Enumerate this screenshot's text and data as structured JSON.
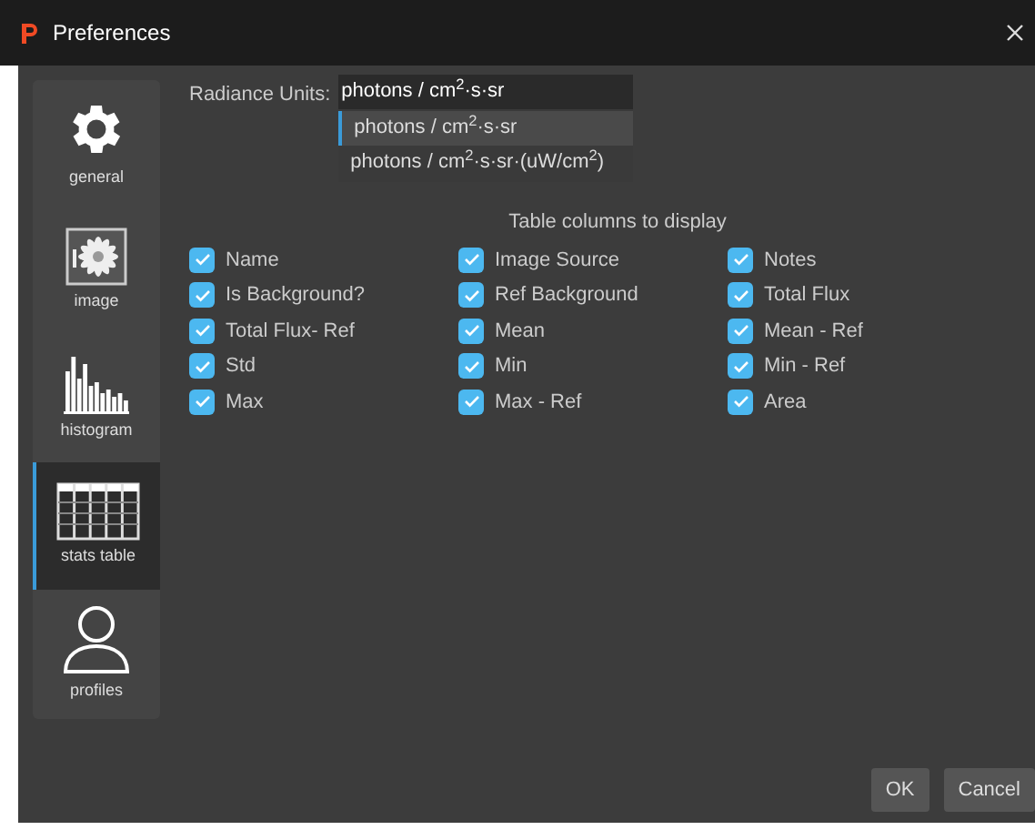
{
  "window": {
    "title": "Preferences"
  },
  "sidebar": {
    "items": [
      {
        "label": "general",
        "kind": "gear",
        "selected": false
      },
      {
        "label": "image",
        "kind": "image",
        "selected": false
      },
      {
        "label": "histogram",
        "kind": "histogram",
        "selected": false
      },
      {
        "label": "stats table",
        "kind": "table",
        "selected": true
      },
      {
        "label": "profiles",
        "kind": "person",
        "selected": false
      }
    ]
  },
  "radiance_units": {
    "label": "Radiance Units:",
    "value": "photons / cm$^{2}$·s·sr",
    "options": [
      {
        "label": "photons / cm$^{2}$·s·sr",
        "selected": true
      },
      {
        "label": "photons / cm$^{2}$·s·sr·(uW/cm$^{2}$)",
        "selected": false
      }
    ]
  },
  "table_columns": {
    "title": "Table columns to display",
    "items": [
      {
        "label": "Name",
        "checked": true
      },
      {
        "label": "Image Source",
        "checked": true
      },
      {
        "label": "Notes",
        "checked": true
      },
      {
        "label": "Is Background?",
        "checked": true
      },
      {
        "label": "Ref Background",
        "checked": true
      },
      {
        "label": "Total Flux",
        "checked": true
      },
      {
        "label": "Total Flux- Ref",
        "checked": true
      },
      {
        "label": "Mean",
        "checked": true
      },
      {
        "label": "Mean - Ref",
        "checked": true
      },
      {
        "label": "Std",
        "checked": true
      },
      {
        "label": "Min",
        "checked": true
      },
      {
        "label": "Min - Ref",
        "checked": true
      },
      {
        "label": "Max",
        "checked": true
      },
      {
        "label": "Max - Ref",
        "checked": true
      },
      {
        "label": "Area",
        "checked": true
      }
    ]
  },
  "buttons": [
    "OK",
    "Cancel"
  ]
}
